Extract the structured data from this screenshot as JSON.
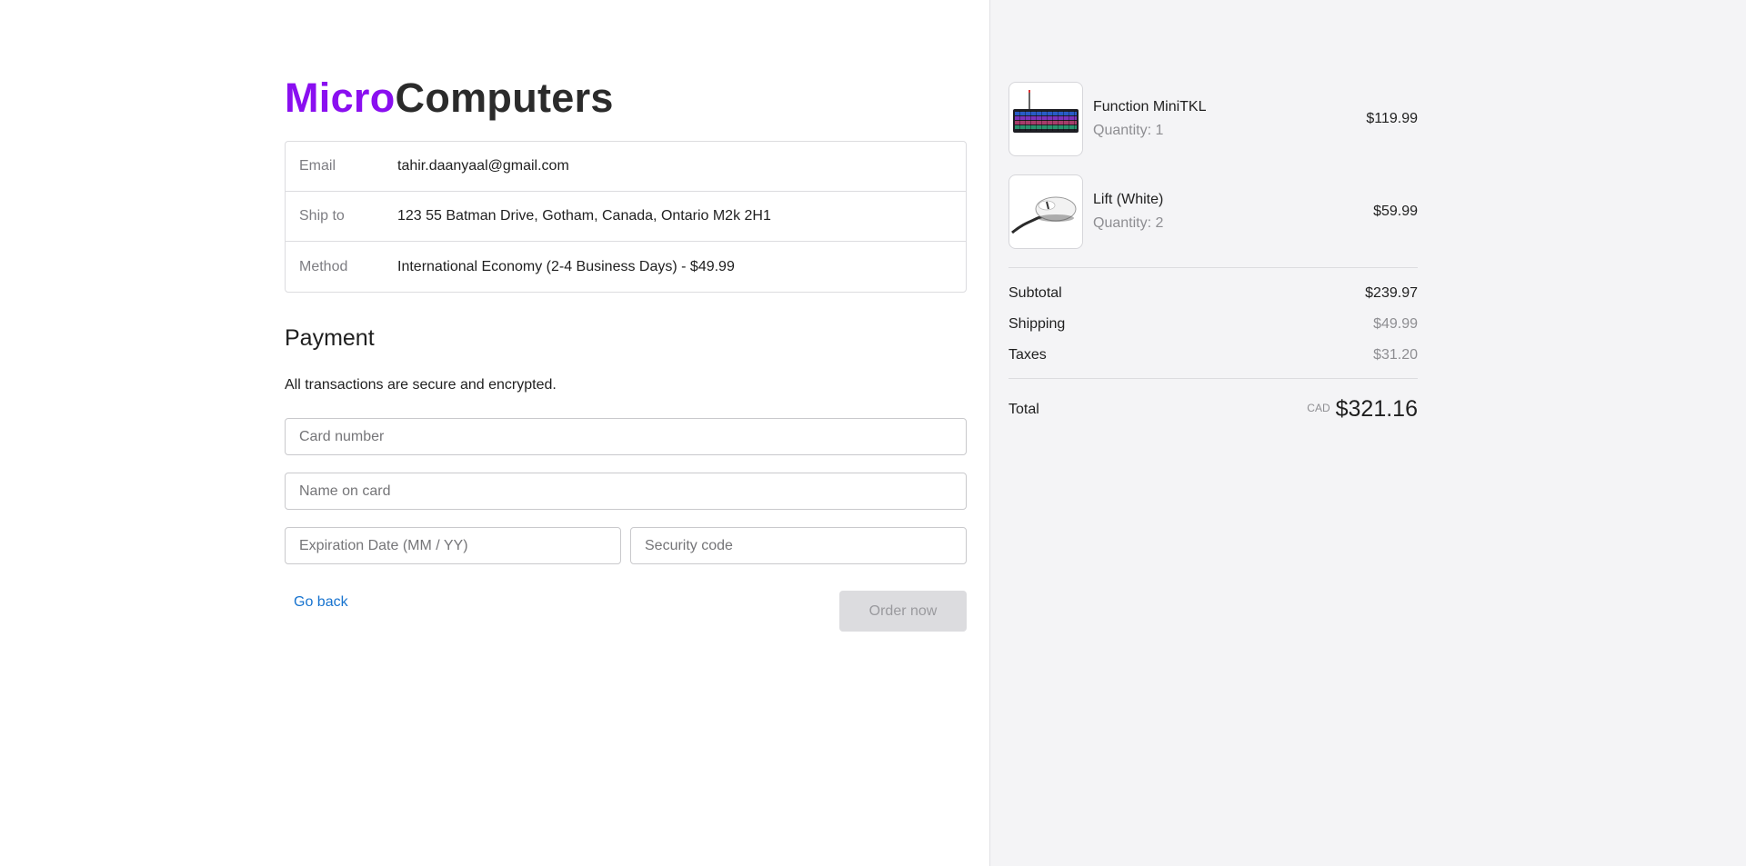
{
  "brand": {
    "part1": "Micro",
    "part2": "Computers",
    "part1_color": "#8a0ff0",
    "part2_color": "#2b2b2b"
  },
  "review": [
    {
      "label": "Email",
      "value": "tahir.daanyaal@gmail.com"
    },
    {
      "label": "Ship to",
      "value": "123 55 Batman Drive, Gotham, Canada, Ontario M2k 2H1"
    },
    {
      "label": "Method",
      "value": "International Economy (2-4 Business Days) - $49.99"
    }
  ],
  "payment": {
    "title": "Payment",
    "subtitle": "All transactions are secure and encrypted.",
    "card_number_placeholder": "Card number",
    "name_placeholder": "Name on card",
    "expiry_placeholder": "Expiration Date (MM / YY)",
    "security_placeholder": "Security code"
  },
  "actions": {
    "back_label": "Go back",
    "order_label": "Order now",
    "link_color": "#1773cf"
  },
  "cart": {
    "items": [
      {
        "name": "Function MiniTKL",
        "quantity": "Quantity: 1",
        "price": "$119.99",
        "icon": "keyboard-icon"
      },
      {
        "name": "Lift (White)",
        "quantity": "Quantity: 2",
        "price": "$59.99",
        "icon": "mouse-icon"
      }
    ],
    "subtotal_label": "Subtotal",
    "subtotal": "$239.97",
    "shipping_label": "Shipping",
    "shipping": "$49.99",
    "taxes_label": "Taxes",
    "taxes": "$31.20",
    "total_label": "Total",
    "currency": "CAD",
    "total": "$321.16"
  }
}
